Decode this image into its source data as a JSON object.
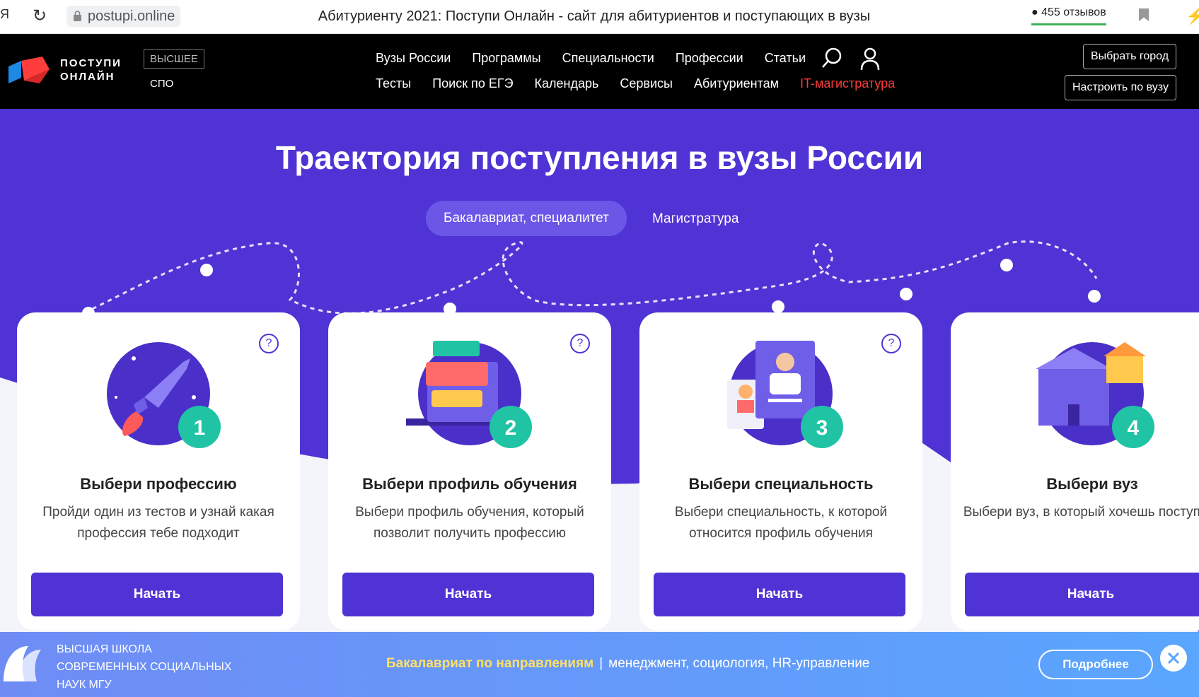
{
  "browser": {
    "left_glyph": "Я",
    "url": "postupi.online",
    "title": "Абитуриенту 2021: Поступи Онлайн - сайт для абитуриентов и поступающих в вузы",
    "reviews": "455 отзывов"
  },
  "header": {
    "logo_line1": "ПОСТУПИ",
    "logo_line2": "ОНЛАЙН",
    "level_higher": "ВЫСШЕЕ",
    "level_spo": "СПО",
    "nav_row1": [
      "Вузы России",
      "Программы",
      "Специальности",
      "Профессии",
      "Статьи"
    ],
    "nav_row2": [
      "Тесты",
      "Поиск по ЕГЭ",
      "Календарь",
      "Сервисы",
      "Абитуриентам"
    ],
    "nav_highlight": "IT-магистратура",
    "btn_city": "Выбрать город",
    "btn_vuz": "Настроить по вузу"
  },
  "hero": {
    "title": "Траектория поступления в вузы России",
    "tab_active": "Бакалавриат, специалитет",
    "tab_other": "Магистратура"
  },
  "cards": [
    {
      "num": "1",
      "title": "Выбери профессию",
      "desc": "Пройди один из тестов и узнай какая профессия тебе подходит",
      "button": "Начать"
    },
    {
      "num": "2",
      "title": "Выбери профиль обучения",
      "desc": "Выбери профиль обучения, который позволит получить профессию",
      "button": "Начать"
    },
    {
      "num": "3",
      "title": "Выбери специальность",
      "desc": "Выбери специальность, к которой относится профиль обучения",
      "button": "Начать"
    },
    {
      "num": "4",
      "title": "Выбери вуз",
      "desc": "Выбери вуз, в который хочешь поступить",
      "button": "Начать"
    }
  ],
  "help_glyph": "?",
  "banner": {
    "school_line1": "ВЫСШАЯ ШКОЛА",
    "school_line2": "СОВРЕМЕННЫХ СОЦИАЛЬНЫХ",
    "school_line3": "НАУК МГУ",
    "highlight": "Бакалавриат по направлениям",
    "separator": "|",
    "text": "менеджмент, социология, HR-управление",
    "button": "Подробнее"
  },
  "colors": {
    "brand": "#5033d4",
    "accent_teal": "#20c4a4",
    "nav_red": "#ff3b3b"
  }
}
